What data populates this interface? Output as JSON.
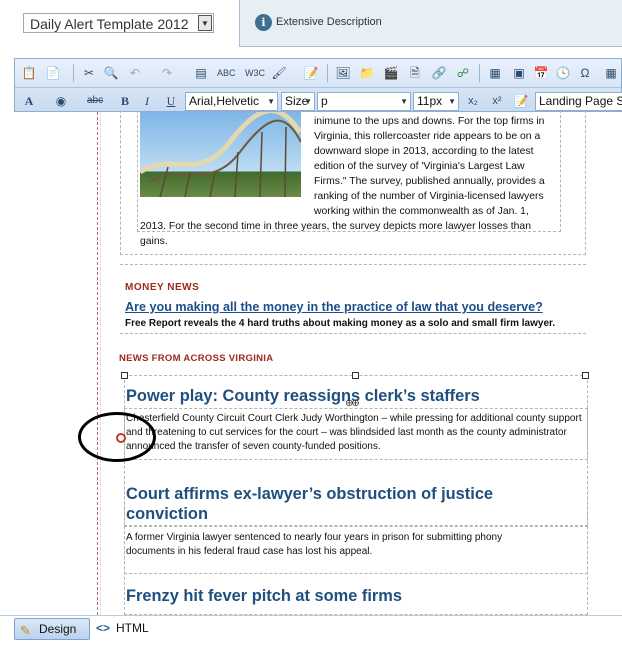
{
  "template_select": {
    "value": "Daily Alert Template 2012"
  },
  "info_panel": {
    "label": "Extensive Description"
  },
  "toolbar": {
    "font_name": "Arial,Helvetic",
    "font_size_label": "Size",
    "paragraph": "p",
    "pixel_size": "11px",
    "css_class": "Landing Page Se",
    "bold": "B",
    "italic": "I",
    "underline": "U",
    "strike": "abc"
  },
  "content": {
    "intro_lines": [
      "inimune to the ups and downs. For the top firms in",
      "Virginia, this rollercoaster ride appears to be on a",
      "downward slope in 2013, according to the latest",
      "edition of the survey of 'Virginia's Largest Law",
      "Firms.\" The survey, published annually, provides a",
      "ranking of the number of Virginia-licensed lawyers",
      "working within the commonwealth as of Jan. 1,",
      "2013. For the second time in three years, the survey depicts more lawyer losses than",
      "gains."
    ],
    "money_news_label": "MONEY NEWS",
    "money_link": "Are you making all the money in the practice of law that you deserve?",
    "money_sub": "Free Report reveals the 4 hard truths about making money as a solo and small firm lawyer.",
    "news_va_label": "NEWS FROM ACROSS VIRGINIA",
    "stories": [
      {
        "headline": "Power play: County reassigns clerk’s staffers",
        "body": "Chesterfield County Circuit Court Clerk Judy Worthington – while pressing for additional county support and threatening to cut services for the court – was blindsided last month as the county administrator announced the transfer of seven county-funded positions."
      },
      {
        "headline": "Court affirms ex-lawyer’s obstruction of justice conviction",
        "body": "A former Virginia lawyer sentenced to nearly four years in prison for submitting phony documents in his federal fraud case has lost his appeal."
      },
      {
        "headline": "Frenzy hit fever pitch at some firms",
        "body": ""
      }
    ]
  },
  "modes": {
    "design": "Design",
    "html": "HTML"
  }
}
